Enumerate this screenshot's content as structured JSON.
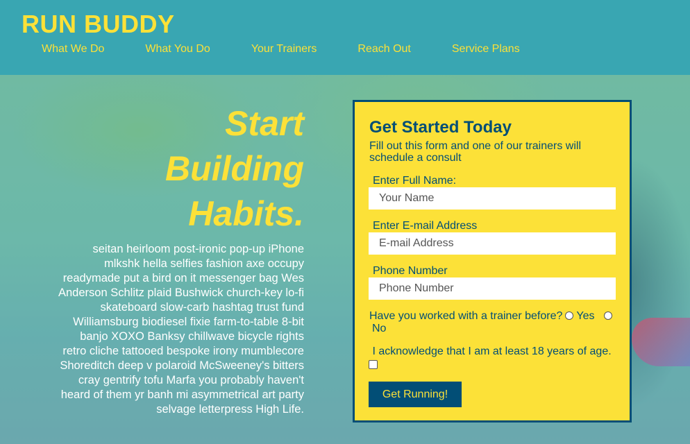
{
  "brand": "RUN BUDDY",
  "nav": [
    "What We Do",
    "What You Do",
    "Your Trainers",
    "Reach Out",
    "Service Plans"
  ],
  "hero": {
    "title_lines": [
      "Start",
      "Building",
      "Habits."
    ],
    "body": "seitan heirloom post-ironic pop-up iPhone mlkshk hella selfies fashion axe occupy readymade put a bird on it messenger bag Wes Anderson Schlitz plaid Bushwick church-key lo-fi skateboard slow-carb hashtag trust fund Williamsburg biodiesel fixie farm-to-table 8-bit banjo XOXO Banksy chillwave bicycle rights retro cliche tattooed bespoke irony mumblecore Shoreditch deep v polaroid McSweeney's bitters cray gentrify tofu Marfa you probably haven't heard of them yr banh mi asymmetrical art party selvage letterpress High Life."
  },
  "form": {
    "title": "Get Started Today",
    "subtitle": "Fill out this form and one of our trainers will schedule a consult",
    "name_label": "Enter Full Name:",
    "name_placeholder": "Your Name",
    "email_label": "Enter E-mail Address",
    "email_placeholder": "E-mail Address",
    "phone_label": "Phone Number",
    "phone_placeholder": "Phone Number",
    "trainer_question": "Have you worked with a trainer before?",
    "yes_label": "Yes",
    "no_label": "No",
    "ack_label": "I acknowledge that I am at least 18 years of age.",
    "submit_label": "Get Running!"
  },
  "colors": {
    "primary": "#39a6b2",
    "accent": "#fce138",
    "dark": "#024e76"
  }
}
